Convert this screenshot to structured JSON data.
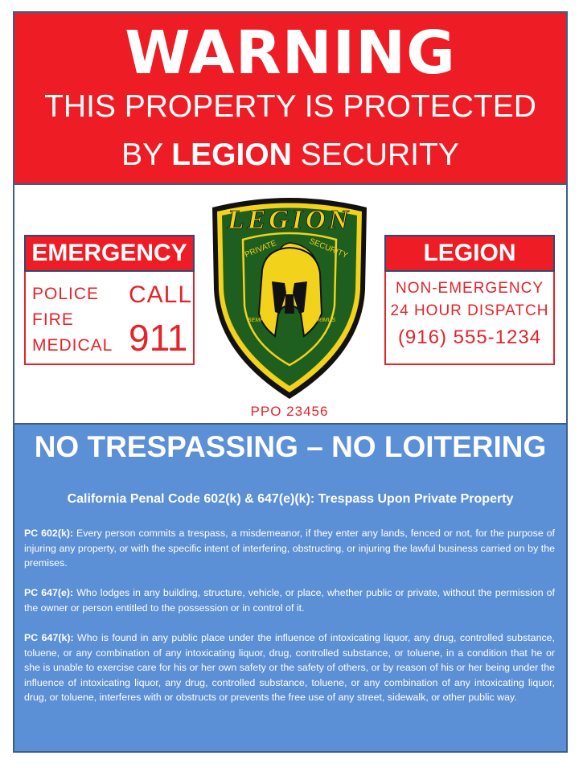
{
  "header": {
    "title": "WARNING",
    "line1": "THIS PROPERTY IS PROTECTED",
    "line2_prefix": "BY ",
    "line2_brand": "LEGION",
    "line2_suffix": " SECURITY",
    "background_color": "#ee1c24"
  },
  "emergency": {
    "heading": "EMERGENCY",
    "services": [
      "POLICE",
      "FIRE",
      "MEDICAL"
    ],
    "call_label": "CALL",
    "number": "911"
  },
  "legion_box": {
    "heading": "LEGION",
    "line1": "NON-EMERGENCY",
    "line2": "24 HOUR DISPATCH",
    "phone": "(916) 555-1234"
  },
  "badge": {
    "name": "LEGION",
    "subtitle_left": "PRIVATE",
    "subtitle_right": "SECURITY",
    "motto_left": "SEMPER",
    "motto_right": "PRIMUS",
    "license": "PPO 23456",
    "shield_color": "#1e5e1e",
    "trim_color": "#f2d21b"
  },
  "notice": {
    "title": "NO TRESPASSING – NO LOITERING",
    "code_line": "California Penal Code 602(k) & 647(e)(k): Trespass Upon Private Property",
    "background_color": "#5b8fd6",
    "paragraphs": [
      {
        "label": "PC 602(k):",
        "text": "  Every person commits a trespass, a misdemeanor, if they enter any lands, fenced or not, for the purpose of injuring any property, or with the specific intent of interfering, obstructing, or injuring the lawful business carried on by the premises."
      },
      {
        "label": "PC 647(e):",
        "text": "  Who lodges in any building, structure, vehicle, or place, whether public or private, without the permission of the owner or person entitled to the possession or in control of it."
      },
      {
        "label": "PC 647(k):",
        "text": " Who is found in any public place under the influence of intoxicating liquor, any drug, controlled substance, toluene, or any combination of any intoxicating liquor, drug, controlled substance, or toluene, in a condition that he or she is unable to exercise care for his or her own safety or the safety of others, or by reason of his or her being under the influence of intoxicating liquor, any drug, controlled substance, toluene, or any combination of any intoxicating liquor, drug, or toluene, interferes with or obstructs or prevents the free use of any street, sidewalk, or other public way."
      }
    ]
  }
}
